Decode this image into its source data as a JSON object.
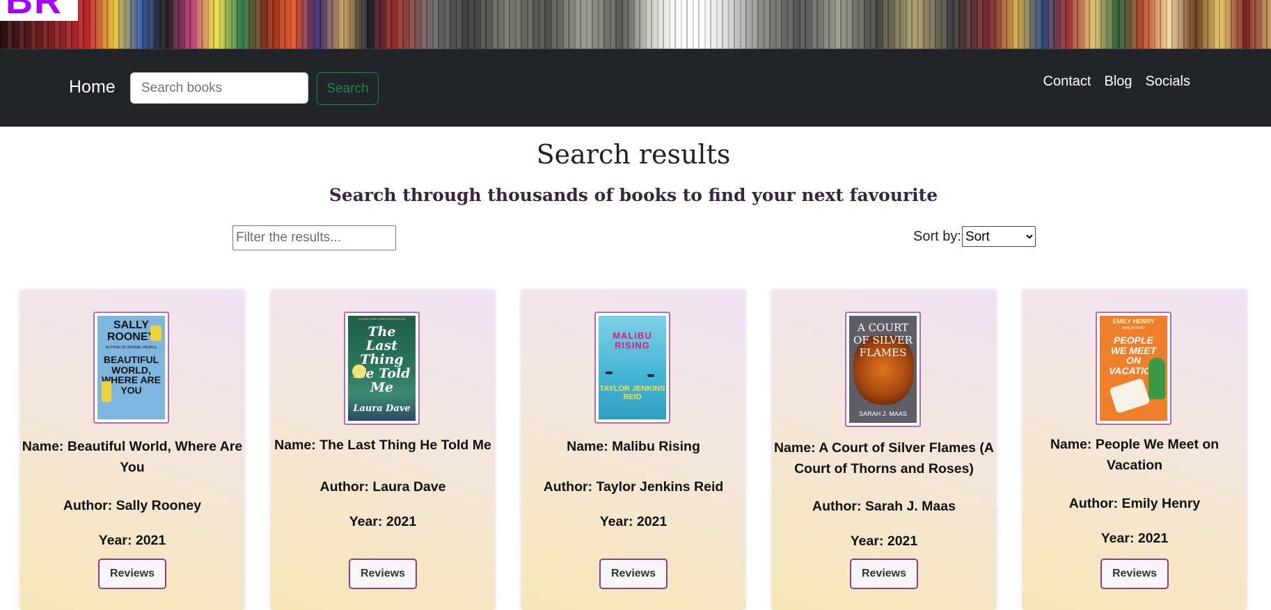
{
  "logo": {
    "text": "BR"
  },
  "navbar": {
    "home_label": "Home",
    "search_placeholder": "Search books",
    "search_button": "Search",
    "links": [
      "Contact",
      "Blog",
      "Socials"
    ]
  },
  "header": {
    "title": "Search results",
    "subtitle": "Search through thousands of books to find your next favourite"
  },
  "controls": {
    "filter_placeholder": "Filter the results...",
    "sort_label": "Sort by:",
    "sort_selected": "Sort"
  },
  "books": [
    {
      "name": "Name: Beautiful World, Where Are You",
      "author": "Author: Sally Rooney",
      "year": "Year: 2021",
      "reviews": "Reviews",
      "cover": {
        "author": "SALLY ROONEY",
        "tag": "AUTHOR OF NORMAL PEOPLE",
        "title": "BEAUTIFUL WORLD, WHERE ARE YOU"
      }
    },
    {
      "name": "Name: The Last Thing He Told Me",
      "author": "Author: Laura Dave",
      "year": "Year: 2021",
      "reviews": "Reviews",
      "cover": {
        "tag": "#1 NEW YORK TIMES BESTSELLER",
        "title": "The Last Thing He Told Me",
        "author": "Laura Dave"
      }
    },
    {
      "name": "Name: Malibu Rising",
      "author": "Author: Taylor Jenkins Reid",
      "year": "Year: 2021",
      "reviews": "Reviews",
      "cover": {
        "title": "MALIBU RISING",
        "author": "TAYLOR JENKINS REID"
      }
    },
    {
      "name": "Name: A Court of Silver Flames (A Court of Thorns and Roses)",
      "author": "Author: Sarah J. Maas",
      "year": "Year: 2021",
      "reviews": "Reviews",
      "cover": {
        "title": "A COURT OF SILVER FLAMES",
        "author": "SARAH J. MAAS"
      }
    },
    {
      "name": "Name: People We Meet on Vacation",
      "author": "Author: Emily Henry",
      "year": "Year: 2021",
      "reviews": "Reviews",
      "cover": {
        "author": "EMILY HENRY",
        "tag": "BEACH READ",
        "title": "PEOPLE WE MEET ON VACATION"
      }
    }
  ]
}
